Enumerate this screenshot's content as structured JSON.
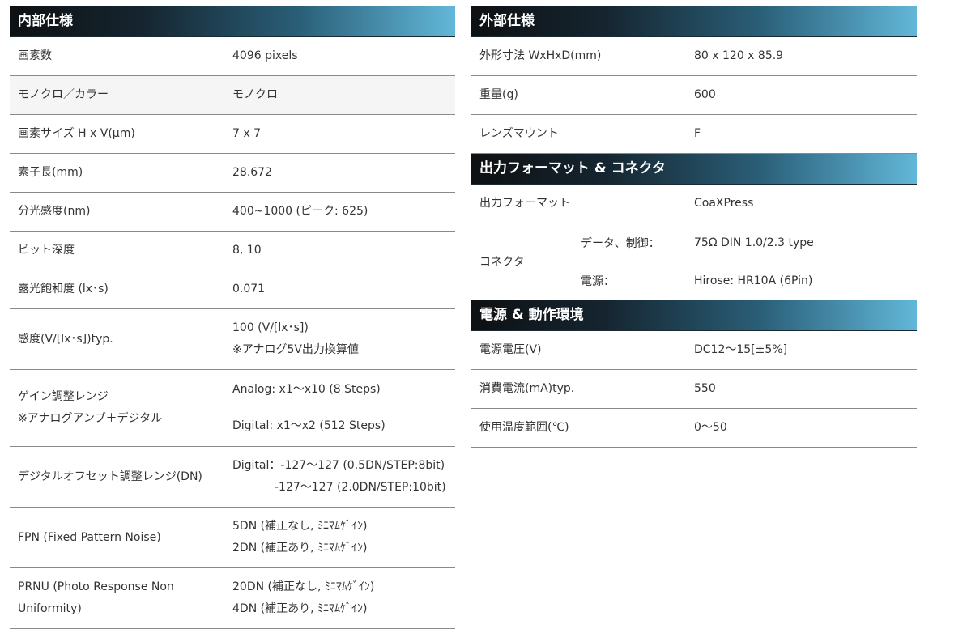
{
  "internal": {
    "title": "内部仕様",
    "rows": [
      {
        "label": "画素数",
        "value": "4096 pixels"
      },
      {
        "label": "モノクロ／カラー",
        "value": "モノクロ"
      },
      {
        "label": "画素サイズ H x V(μm)",
        "value": "7 x 7"
      },
      {
        "label": "素子長(mm)",
        "value": "28.672"
      },
      {
        "label": "分光感度(nm)",
        "value": "400~1000 (ピーク: 625)"
      },
      {
        "label": "ビット深度",
        "value": "8, 10"
      },
      {
        "label": "露光飽和度 (lx･s)",
        "value": "0.071"
      },
      {
        "label": "感度(V/[lx･s])typ.",
        "value": "100 (V/[lx･s])",
        "value2": "※アナログ5V出力換算値"
      },
      {
        "label": "ゲイン調整レンジ",
        "label2": "※アナログアンプ＋デジタル",
        "value": "Analog: x1～x10 (8 Steps)",
        "value2": "Digital: x1～x2 (512 Steps)"
      },
      {
        "label": "デジタルオフセット調整レンジ(DN)",
        "value": "Digital：-127～127 (0.5DN/STEP:8bit)",
        "value2": "-127～127 (2.0DN/STEP:10bit)"
      },
      {
        "label": "FPN (Fixed Pattern Noise)",
        "value": "5DN (補正なし, ﾐﾆﾏﾑｹﾞｲﾝ)",
        "value2": "2DN (補正あり, ﾐﾆﾏﾑｹﾞｲﾝ)"
      },
      {
        "label": "PRNU (Photo Response Non Uniformity)",
        "value": "20DN (補正なし, ﾐﾆﾏﾑｹﾞｲﾝ)",
        "value2": "4DN (補正あり, ﾐﾆﾏﾑｹﾞｲﾝ)"
      }
    ]
  },
  "external": {
    "title": "外部仕様",
    "rows": [
      {
        "label": "外形寸法 WxHxD(mm)",
        "value": "80 x 120 x 85.9"
      },
      {
        "label": "重量(g)",
        "value": "600"
      },
      {
        "label": "レンズマウント",
        "value": "F"
      }
    ]
  },
  "output": {
    "title": "出力フォーマット & コネクタ",
    "format_label": "出力フォーマット",
    "format_value": "CoaXPress",
    "connector_label": "コネクタ",
    "connector_rows": [
      {
        "label": "データ、制御：",
        "value": "75Ω DIN 1.0/2.3 type"
      },
      {
        "label": "電源：",
        "value": "Hirose: HR10A (6Pin)"
      }
    ]
  },
  "power": {
    "title": "電源 & 動作環境",
    "rows": [
      {
        "label": "電源電圧(V)",
        "value": "DC12～15[±5%]"
      },
      {
        "label": "消費電流(mA)typ.",
        "value": "550"
      },
      {
        "label": "使用温度範囲(℃)",
        "value": "0～50"
      }
    ]
  },
  "colors": {
    "header_gradient_start": "#0e1012",
    "header_gradient_end": "#62b7d9",
    "row_border": "#8a8a8a"
  }
}
